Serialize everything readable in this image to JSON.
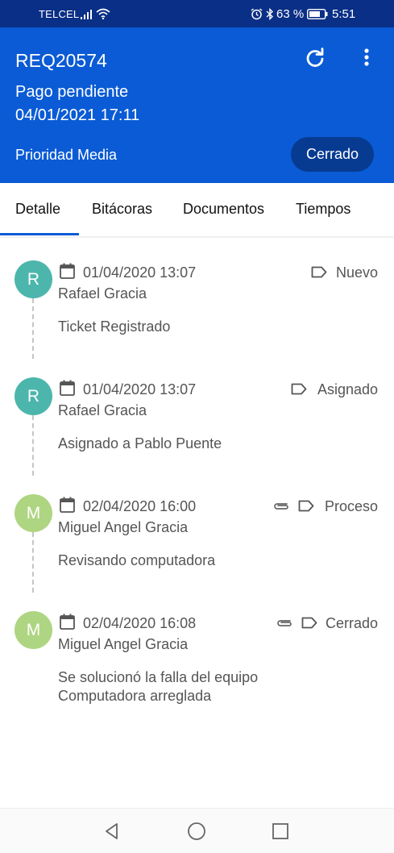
{
  "status_bar": {
    "carrier": "TELCEL",
    "battery_percent": "63 %",
    "time": "5:51",
    "icons": [
      "signal-icon",
      "wifi-icon",
      "alarm-icon",
      "bluetooth-icon",
      "battery-icon"
    ]
  },
  "header": {
    "ticket_id": "REQ20574",
    "title": "Pago pendiente",
    "date": "04/01/2021 17:11",
    "priority": "Prioridad Media",
    "status_chip": "Cerrado",
    "icons": [
      "refresh-icon",
      "more-vertical-icon"
    ]
  },
  "tabs": [
    {
      "label": "Detalle",
      "active": true
    },
    {
      "label": "Bitácoras",
      "active": false
    },
    {
      "label": "Documentos",
      "active": false
    },
    {
      "label": "Tiempos",
      "active": false
    }
  ],
  "entries": [
    {
      "initial": "R",
      "avatar_color": "#4db6ac",
      "date": "01/04/2020 13:07",
      "user": "Rafael Gracia",
      "status": "Nuevo",
      "attachment": false,
      "description": "Ticket Registrado",
      "description_line2": ""
    },
    {
      "initial": "R",
      "avatar_color": "#4db6ac",
      "date": "01/04/2020 13:07",
      "user": "Rafael Gracia",
      "status": "Asignado",
      "attachment": false,
      "description": "Asignado a Pablo Puente",
      "description_line2": ""
    },
    {
      "initial": "M",
      "avatar_color": "#aed581",
      "date": "02/04/2020 16:00",
      "user": "Miguel Angel Gracia",
      "status": "Proceso",
      "attachment": true,
      "description": "Revisando computadora",
      "description_line2": ""
    },
    {
      "initial": "M",
      "avatar_color": "#aed581",
      "date": "02/04/2020 16:08",
      "user": "Miguel Angel Gracia",
      "status": "Cerrado",
      "attachment": true,
      "description": "Se solucionó la falla del equipo",
      "description_line2": "Computadora arreglada"
    }
  ],
  "colors": {
    "status_bar_bg": "#0a2f86",
    "header_bg": "#0a5bd5",
    "chip_bg": "#073b91",
    "accent": "#0a5bd5"
  },
  "navbar": {
    "icons": [
      "back-icon",
      "home-icon",
      "recent-apps-icon"
    ]
  }
}
